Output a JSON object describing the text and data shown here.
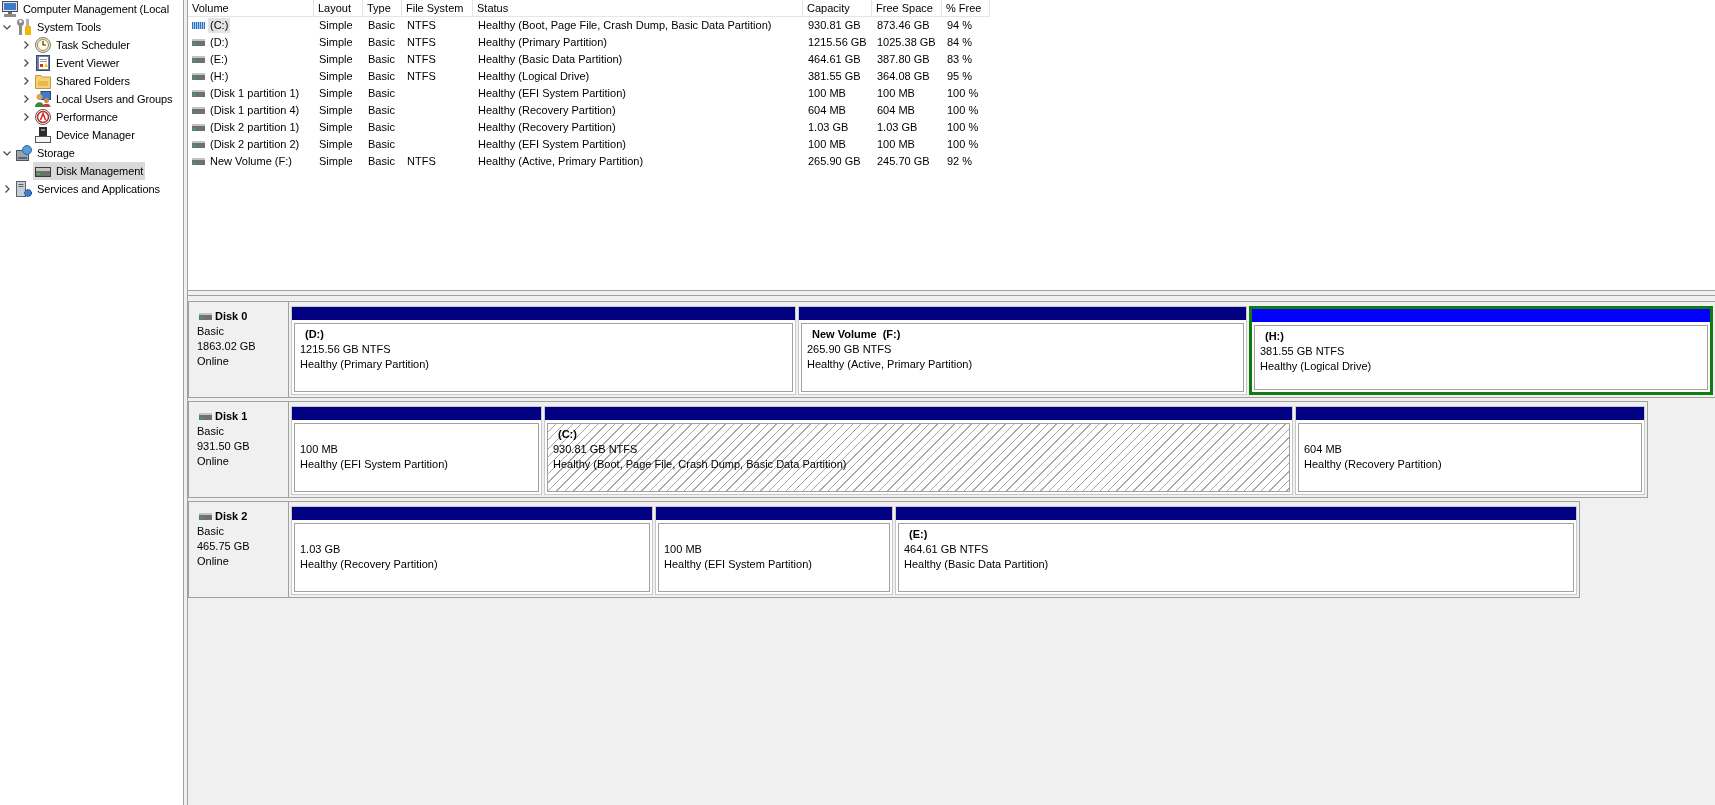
{
  "tree": {
    "items": [
      {
        "label": "Computer Management (Local",
        "kind": "computer",
        "selected": false,
        "children": [
          {
            "label": "System Tools",
            "kind": "tools",
            "expanded": true,
            "selected": false,
            "children": [
              {
                "label": "Task Scheduler",
                "kind": "scheduler",
                "expanded": false,
                "selected": false
              },
              {
                "label": "Event Viewer",
                "kind": "events",
                "expanded": false,
                "selected": false
              },
              {
                "label": "Shared Folders",
                "kind": "shares",
                "expanded": false,
                "selected": false
              },
              {
                "label": "Local Users and Groups",
                "kind": "users",
                "expanded": false,
                "selected": false
              },
              {
                "label": "Performance",
                "kind": "performance",
                "expanded": false,
                "selected": false
              },
              {
                "label": "Device Manager",
                "kind": "devices",
                "selected": false
              }
            ]
          },
          {
            "label": "Storage",
            "kind": "storage",
            "expanded": true,
            "selected": false,
            "children": [
              {
                "label": "Disk Management",
                "kind": "disks",
                "selected": true
              }
            ]
          },
          {
            "label": "Services and Applications",
            "kind": "services",
            "expanded": false,
            "selected": false
          }
        ]
      }
    ]
  },
  "volume_list": {
    "columns": [
      "Volume",
      "Layout",
      "Type",
      "File System",
      "Status",
      "Capacity",
      "Free Space",
      "% Free"
    ],
    "rows": [
      {
        "volume": "(C:)",
        "layout": "Simple",
        "type": "Basic",
        "file_system": "NTFS",
        "status": "Healthy (Boot, Page File, Crash Dump, Basic Data Partition)",
        "capacity": "930.81 GB",
        "free_space": "873.46 GB",
        "percent_free": "94 %",
        "selected": true
      },
      {
        "volume": "(D:)",
        "layout": "Simple",
        "type": "Basic",
        "file_system": "NTFS",
        "status": "Healthy (Primary Partition)",
        "capacity": "1215.56 GB",
        "free_space": "1025.38 GB",
        "percent_free": "84 %",
        "selected": false
      },
      {
        "volume": "(E:)",
        "layout": "Simple",
        "type": "Basic",
        "file_system": "NTFS",
        "status": "Healthy (Basic Data Partition)",
        "capacity": "464.61 GB",
        "free_space": "387.80 GB",
        "percent_free": "83 %",
        "selected": false
      },
      {
        "volume": "(H:)",
        "layout": "Simple",
        "type": "Basic",
        "file_system": "NTFS",
        "status": "Healthy (Logical Drive)",
        "capacity": "381.55 GB",
        "free_space": "364.08 GB",
        "percent_free": "95 %",
        "selected": false
      },
      {
        "volume": "(Disk 1 partition 1)",
        "layout": "Simple",
        "type": "Basic",
        "status": "Healthy (EFI System Partition)",
        "capacity": "100 MB",
        "free_space": "100 MB",
        "percent_free": "100 %",
        "selected": false
      },
      {
        "volume": "(Disk 1 partition 4)",
        "layout": "Simple",
        "type": "Basic",
        "status": "Healthy (Recovery Partition)",
        "capacity": "604 MB",
        "free_space": "604 MB",
        "percent_free": "100 %",
        "selected": false
      },
      {
        "volume": "(Disk 2 partition 1)",
        "layout": "Simple",
        "type": "Basic",
        "status": "Healthy (Recovery Partition)",
        "capacity": "1.03 GB",
        "free_space": "1.03 GB",
        "percent_free": "100 %",
        "selected": false
      },
      {
        "volume": "(Disk 2 partition 2)",
        "layout": "Simple",
        "type": "Basic",
        "status": "Healthy (EFI System Partition)",
        "capacity": "100 MB",
        "free_space": "100 MB",
        "percent_free": "100 %",
        "selected": false
      },
      {
        "volume": "New Volume (F:)",
        "layout": "Simple",
        "type": "Basic",
        "file_system": "NTFS",
        "status": "Healthy (Active, Primary Partition)",
        "capacity": "265.90 GB",
        "free_space": "245.70 GB",
        "percent_free": "92 %",
        "selected": false
      }
    ]
  },
  "disks": [
    {
      "name": "Disk 0",
      "type": "Basic",
      "size": "1863.02 GB",
      "state": "Online",
      "partitions": [
        {
          "kind": "primary",
          "title": "(D:)",
          "size": "1215.56 GB NTFS",
          "status": "Healthy (Primary Partition)",
          "selected": false,
          "focused": false
        },
        {
          "kind": "primary",
          "title": "New Volume  (F:)",
          "size": "265.90 GB NTFS",
          "status": "Healthy (Active, Primary Partition)",
          "selected": false,
          "focused": false
        },
        {
          "kind": "logical",
          "title": "(H:)",
          "size": "381.55 GB NTFS",
          "status": "Healthy (Logical Drive)",
          "selected": false,
          "focused": true
        }
      ]
    },
    {
      "name": "Disk 1",
      "type": "Basic",
      "size": "931.50 GB",
      "state": "Online",
      "partitions": [
        {
          "kind": "primary",
          "size": "100 MB",
          "status": "Healthy (EFI System Partition)",
          "selected": false,
          "focused": false
        },
        {
          "kind": "primary",
          "title": "(C:)",
          "size": "930.81 GB NTFS",
          "status": "Healthy (Boot, Page File, Crash Dump, Basic Data Partition)",
          "selected": true,
          "focused": false
        },
        {
          "kind": "primary",
          "size": "604 MB",
          "status": "Healthy (Recovery Partition)",
          "selected": false,
          "focused": false
        }
      ]
    },
    {
      "name": "Disk 2",
      "type": "Basic",
      "size": "465.75 GB",
      "state": "Online",
      "partitions": [
        {
          "kind": "primary",
          "size": "1.03 GB",
          "status": "Healthy (Recovery Partition)",
          "selected": false,
          "focused": false
        },
        {
          "kind": "primary",
          "size": "100 MB",
          "status": "Healthy (EFI System Partition)",
          "selected": false,
          "focused": false
        },
        {
          "kind": "primary",
          "title": "(E:)",
          "size": "464.61 GB NTFS",
          "status": "Healthy (Basic Data Partition)",
          "selected": false,
          "focused": false
        }
      ]
    }
  ]
}
